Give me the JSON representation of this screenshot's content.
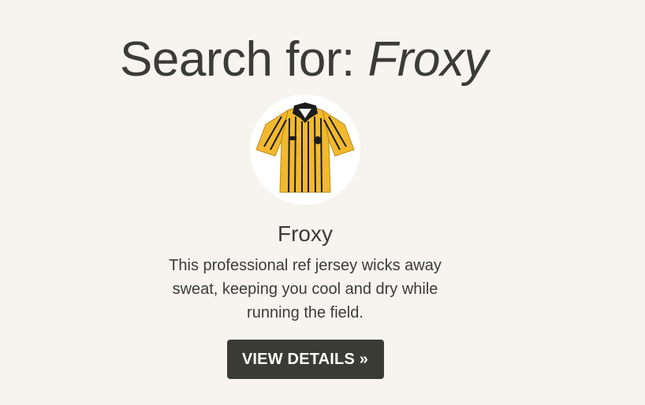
{
  "search": {
    "prefix": "Search for: ",
    "query": "Froxy"
  },
  "result": {
    "image_icon": "referee-jersey-image",
    "name": "Froxy",
    "description": "This professional ref jersey wicks away sweat, keeping you cool and dry while running the field.",
    "button_label": "VIEW DETAILS »"
  },
  "colors": {
    "background": "#f7f4f0",
    "text": "#3b3b38",
    "button_bg": "#3b3b36",
    "button_text": "#ffffff",
    "jersey_yellow": "#f2b92f",
    "jersey_black": "#1c1c1c"
  }
}
